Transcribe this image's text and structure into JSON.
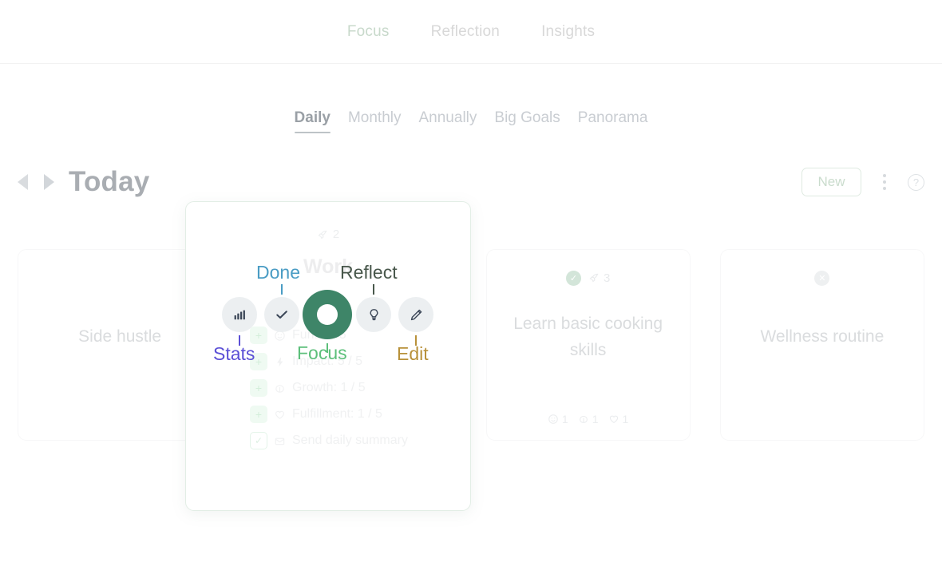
{
  "top_nav": {
    "items": [
      {
        "label": "Focus",
        "active": true
      },
      {
        "label": "Reflection",
        "active": false
      },
      {
        "label": "Insights",
        "active": false
      }
    ]
  },
  "sub_tabs": {
    "items": [
      {
        "label": "Daily",
        "active": true
      },
      {
        "label": "Monthly",
        "active": false
      },
      {
        "label": "Annually",
        "active": false
      },
      {
        "label": "Big Goals",
        "active": false
      },
      {
        "label": "Panorama",
        "active": false
      }
    ]
  },
  "page_header": {
    "title": "Today",
    "prev_label": "Previous",
    "next_label": "Next",
    "new_button": "New",
    "more_label": "More options",
    "help_label": "?"
  },
  "cards": [
    {
      "title": "Side hustle",
      "badge": "",
      "rocket_count": "",
      "stats": []
    },
    {
      "title": "Work",
      "badge": "",
      "rocket_count": "2",
      "stats": []
    },
    {
      "title": "Learn basic cooking skills",
      "badge": "check",
      "rocket_count": "3",
      "stats": [
        {
          "icon": "smiley-icon",
          "value": "1"
        },
        {
          "icon": "growth-icon",
          "value": "1"
        },
        {
          "icon": "heart-icon",
          "value": "1"
        }
      ]
    },
    {
      "title": "Wellness routine",
      "badge": "x",
      "rocket_count": "",
      "stats": []
    }
  ],
  "detail_panel": {
    "rocket_count": "2",
    "title": "Work",
    "attributes": [
      {
        "icon": "smiley-icon",
        "label": "Fun: 2 / 5"
      },
      {
        "icon": "bolt-icon",
        "label": "Impact: 5 / 5"
      },
      {
        "icon": "growth-icon",
        "label": "Growth: 1 / 5"
      },
      {
        "icon": "heart-icon",
        "label": "Fulfillment: 1 / 5"
      }
    ],
    "checkbox_row": {
      "icon": "envelope-icon",
      "label": "Send daily summary"
    }
  },
  "radial_menu": {
    "actions": [
      {
        "id": "stats",
        "label": "Stats",
        "icon": "bar-chart-icon",
        "color": "#5b4fd6",
        "position": "bottom"
      },
      {
        "id": "done",
        "label": "Done",
        "icon": "check-icon",
        "color": "#4a9cc4",
        "position": "top"
      },
      {
        "id": "focus",
        "label": "Focus",
        "icon": "focus-ring-icon",
        "color": "#5cbf7a",
        "position": "bottom"
      },
      {
        "id": "reflect",
        "label": "Reflect",
        "icon": "lightbulb-icon",
        "color": "#48574b",
        "position": "top"
      },
      {
        "id": "edit",
        "label": "Edit",
        "icon": "pencil-icon",
        "color": "#b8913a",
        "position": "bottom"
      }
    ]
  },
  "colors": {
    "focus_green": "#3e8568",
    "accent_sage": "#c8d9cb",
    "icon_slate": "#3b4657",
    "button_circle_bg": "#eceff1"
  }
}
